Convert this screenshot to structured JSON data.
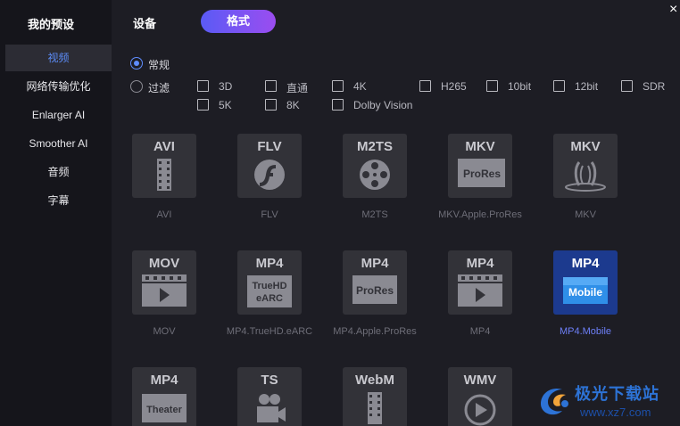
{
  "header": {
    "title": "我的预设",
    "tab_device": "设备",
    "tab_format": "格式",
    "close_glyph": "×"
  },
  "sidebar": {
    "items": [
      {
        "label": "视频",
        "active": true
      },
      {
        "label": "网络传输优化"
      },
      {
        "label": "Enlarger AI"
      },
      {
        "label": "Smoother AI"
      },
      {
        "label": "音频"
      },
      {
        "label": "字幕"
      }
    ]
  },
  "filters": {
    "radio_normal": "常规",
    "radio_filter": "过滤",
    "checkboxes": [
      "3D",
      "直通",
      "4K",
      "H265",
      "10bit",
      "12bit",
      "SDR",
      "5K",
      "8K",
      "Dolby Vision"
    ]
  },
  "formats": [
    {
      "title": "AVI",
      "icon": "film-icon",
      "label": "AVI"
    },
    {
      "title": "FLV",
      "icon": "flash-icon",
      "label": "FLV"
    },
    {
      "title": "M2TS",
      "icon": "reel-icon",
      "label": "M2TS"
    },
    {
      "title": "MKV",
      "icon": "prores-badge-icon",
      "badge": "ProRes",
      "label": "MKV.Apple.ProRes"
    },
    {
      "title": "MKV",
      "icon": "matroska-icon",
      "label": "MKV"
    },
    {
      "title": "MOV",
      "icon": "clapper-play-icon",
      "label": "MOV"
    },
    {
      "title": "MP4",
      "icon": "truehd-badge-icon",
      "badge": "TrueHD eARC",
      "label": "MP4.TrueHD.eARC"
    },
    {
      "title": "MP4",
      "icon": "prores-badge-icon",
      "badge": "ProRes",
      "label": "MP4.Apple.ProRes"
    },
    {
      "title": "MP4",
      "icon": "clapper-play-icon",
      "label": "MP4"
    },
    {
      "title": "MP4",
      "icon": "mobile-badge-icon",
      "badge": "Mobile",
      "label": "MP4.Mobile",
      "selected": true
    },
    {
      "title": "MP4",
      "icon": "theater-badge-icon",
      "badge": "Theater",
      "label": ""
    },
    {
      "title": "TS",
      "icon": "camera-icon",
      "label": ""
    },
    {
      "title": "WebM",
      "icon": "film-icon",
      "label": ""
    },
    {
      "title": "WMV",
      "icon": "play-circle-icon",
      "label": ""
    }
  ],
  "watermark": {
    "text": "极光下载站",
    "url": "www.xz7.com"
  },
  "colors": {
    "accent": "#5f8dff",
    "selected_tile": "#1c3a8e",
    "gradient_start": "#5a5bf5",
    "gradient_end": "#9b4df0"
  }
}
